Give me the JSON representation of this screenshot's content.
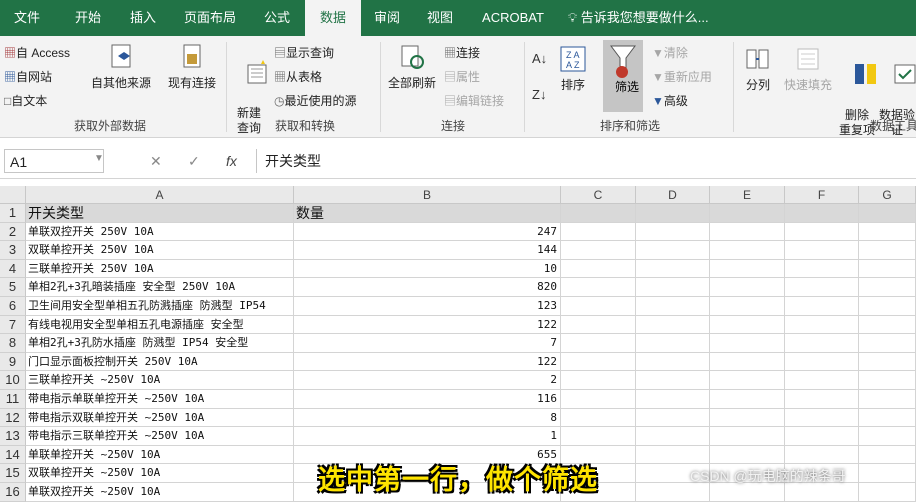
{
  "tabs": [
    "文件",
    "开始",
    "插入",
    "页面布局",
    "公式",
    "数据",
    "审阅",
    "视图",
    "ACROBAT"
  ],
  "tell_me": "告诉我您想要做什么...",
  "ribbon": {
    "get_external": {
      "access": "自 Access",
      "web": "自网站",
      "text": "自文本",
      "other": "自其他来源",
      "existing": "现有连接",
      "label": "获取外部数据"
    },
    "transform": {
      "new_query": "新建\n查询",
      "show_queries": "显示查询",
      "from_table": "从表格",
      "recent_sources": "最近使用的源",
      "label": "获取和转换"
    },
    "connections": {
      "refresh_all": "全部刷新",
      "connections": "连接",
      "properties": "属性",
      "edit_links": "编辑链接",
      "label": "连接"
    },
    "sort_filter": {
      "sort": "排序",
      "filter": "筛选",
      "clear": "清除",
      "reapply": "重新应用",
      "advanced": "高级",
      "label": "排序和筛选"
    },
    "data_tools": {
      "split": "分列",
      "flash_fill": "快速填充",
      "remove_dup": "删除\n重复项",
      "validation": "数据验\n证",
      "label": "数据工具"
    }
  },
  "formula_bar": {
    "name_box": "A1",
    "fx": "fx",
    "content": "开关类型"
  },
  "columns": [
    "A",
    "B",
    "C",
    "D",
    "E",
    "F",
    "G"
  ],
  "rows": [
    {
      "n": "1",
      "a": "开关类型",
      "b": "数量"
    },
    {
      "n": "2",
      "a": "单联双控开关 250V 10A",
      "b": "247"
    },
    {
      "n": "3",
      "a": "双联单控开关 250V 10A",
      "b": "144"
    },
    {
      "n": "4",
      "a": "三联单控开关 250V 10A",
      "b": "10"
    },
    {
      "n": "5",
      "a": "单相2孔+3孔暗装插座 安全型 250V 10A",
      "b": "820"
    },
    {
      "n": "6",
      "a": "卫生间用安全型单相五孔防溅插座 防溅型 IP54",
      "b": "123"
    },
    {
      "n": "7",
      "a": "有线电视用安全型单相五孔电源插座 安全型",
      "b": "122"
    },
    {
      "n": "8",
      "a": "单相2孔+3孔防水插座 防溅型 IP54 安全型",
      "b": "7"
    },
    {
      "n": "9",
      "a": "门口显示面板控制开关 250V 10A",
      "b": "122"
    },
    {
      "n": "10",
      "a": "三联单控开关 ~250V  10A",
      "b": "2"
    },
    {
      "n": "11",
      "a": "带电指示单联单控开关 ~250V  10A",
      "b": "116"
    },
    {
      "n": "12",
      "a": "带电指示双联单控开关 ~250V  10A",
      "b": "8"
    },
    {
      "n": "13",
      "a": "带电指示三联单控开关 ~250V  10A",
      "b": "1"
    },
    {
      "n": "14",
      "a": "单联单控开关 ~250V  10A",
      "b": "655"
    },
    {
      "n": "15",
      "a": "双联单控开关 ~250V  10A",
      "b": ""
    },
    {
      "n": "16",
      "a": "单联双控开关 ~250V  10A",
      "b": ""
    }
  ],
  "caption": "选中第一行，做个筛选",
  "watermark": "CSDN @玩电脑的辣条哥"
}
